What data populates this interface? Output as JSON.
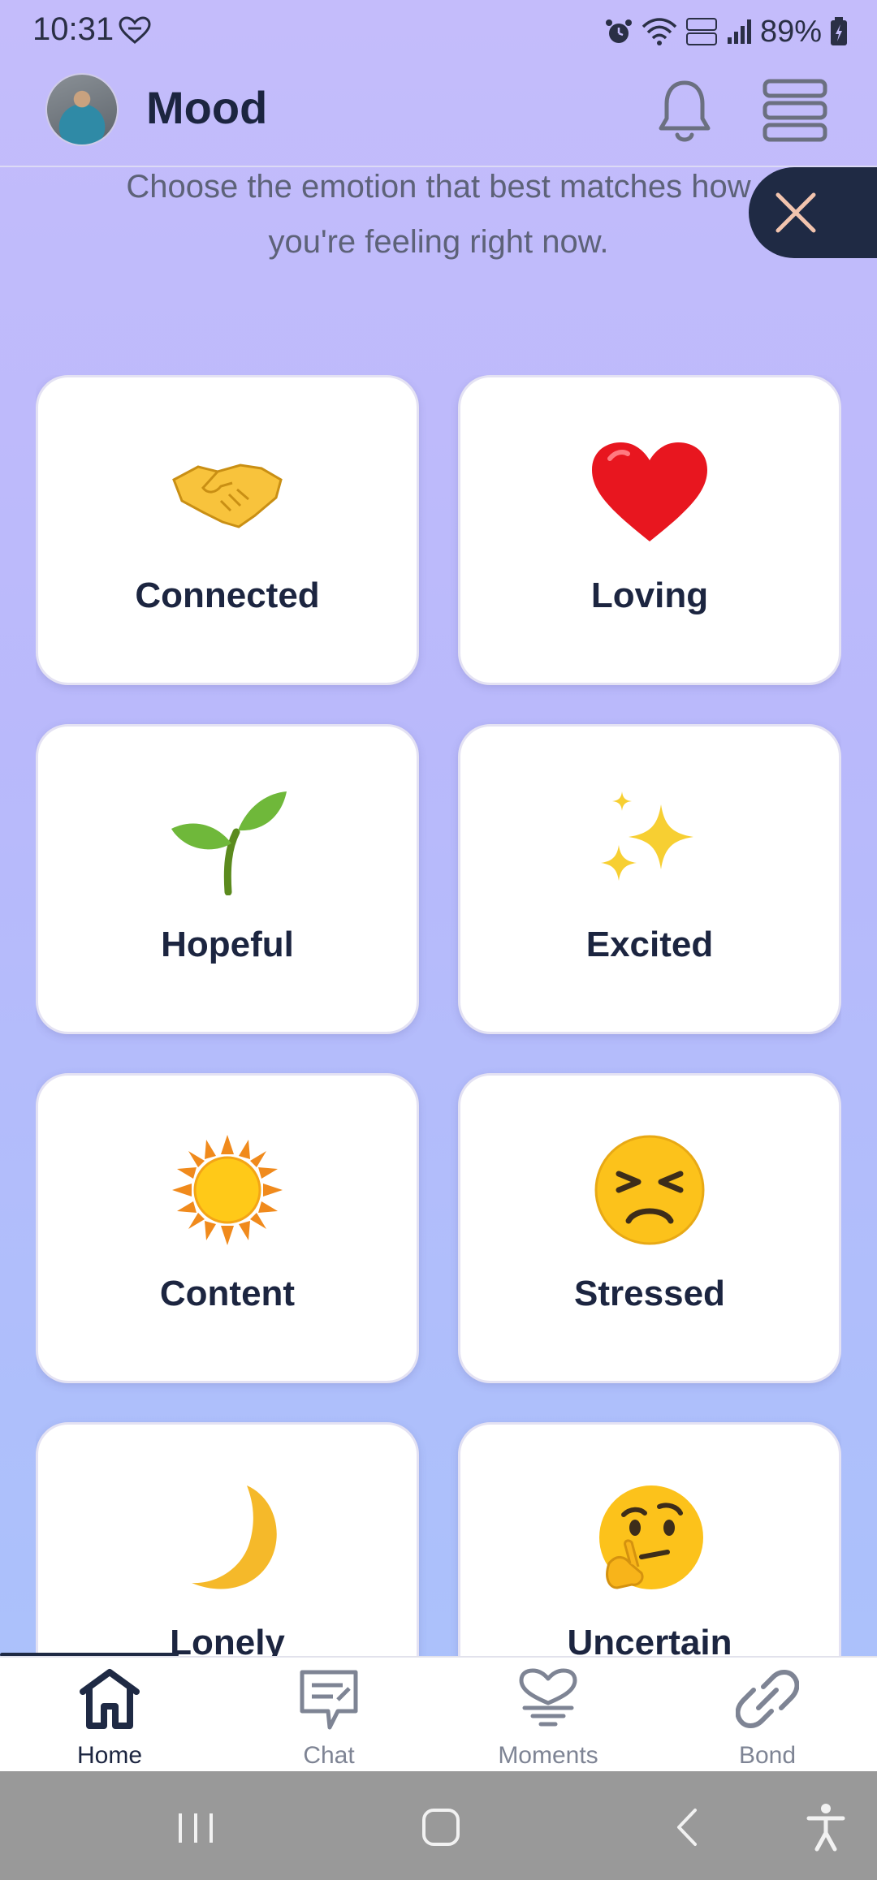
{
  "status_bar": {
    "time": "10:31",
    "battery": "89%"
  },
  "header": {
    "title": "Mood",
    "bell_icon": "bell-icon",
    "menu_icon": "menu-icon"
  },
  "prompt": {
    "line1": "Choose the emotion that best matches how",
    "line2": "you're feeling right now."
  },
  "moods": [
    {
      "label": "Connected",
      "icon": "handshake-emoji"
    },
    {
      "label": "Loving",
      "icon": "red-heart-emoji"
    },
    {
      "label": "Hopeful",
      "icon": "seedling-emoji"
    },
    {
      "label": "Excited",
      "icon": "sparkles-emoji"
    },
    {
      "label": "Content",
      "icon": "sun-emoji"
    },
    {
      "label": "Stressed",
      "icon": "persevering-face-emoji"
    },
    {
      "label": "Lonely",
      "icon": "crescent-moon-emoji"
    },
    {
      "label": "Uncertain",
      "icon": "thinking-face-emoji"
    }
  ],
  "bottom_nav": {
    "items": [
      {
        "label": "Home",
        "icon": "home-icon",
        "active": true
      },
      {
        "label": "Chat",
        "icon": "chat-icon",
        "active": false
      },
      {
        "label": "Moments",
        "icon": "moments-heart-icon",
        "active": false
      },
      {
        "label": "Bond",
        "icon": "link-icon",
        "active": false
      }
    ]
  },
  "colors": {
    "accent_dark": "#1f2a44",
    "background_top": "#c4bcfb",
    "background_bottom": "#a9c3fb",
    "card": "#ffffff"
  }
}
